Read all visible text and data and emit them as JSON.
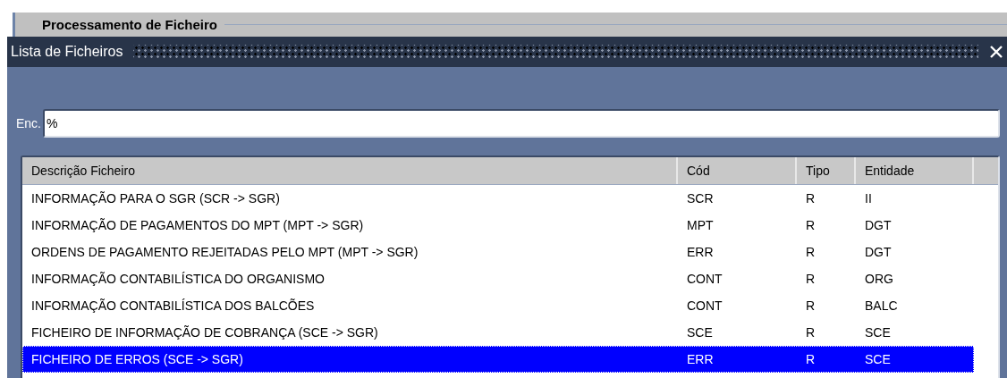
{
  "frame": {
    "title": "Processamento de Ficheiro"
  },
  "dialog": {
    "title": "Lista de Ficheiros"
  },
  "search": {
    "label": "Enc.",
    "value": "%"
  },
  "table": {
    "columns": [
      "Descrição Ficheiro",
      "Cód",
      "Tipo",
      "Entidade"
    ],
    "rows": [
      {
        "cells": [
          "INFORMAÇÃO PARA O SGR (SCR -> SGR)",
          "SCR",
          "R",
          "II"
        ],
        "selected": false
      },
      {
        "cells": [
          "INFORMAÇÃO DE PAGAMENTOS DO MPT (MPT -> SGR)",
          "MPT",
          "R",
          "DGT"
        ],
        "selected": false
      },
      {
        "cells": [
          "ORDENS DE PAGAMENTO REJEITADAS PELO MPT (MPT -> SGR)",
          "ERR",
          "R",
          "DGT"
        ],
        "selected": false
      },
      {
        "cells": [
          "INFORMAÇÃO CONTABILÍSTICA DO ORGANISMO",
          "CONT",
          "R",
          "ORG"
        ],
        "selected": false
      },
      {
        "cells": [
          "INFORMAÇÃO CONTABILÍSTICA DOS BALCÕES",
          "CONT",
          "R",
          "BALC"
        ],
        "selected": false
      },
      {
        "cells": [
          "FICHEIRO DE INFORMAÇÃO DE COBRANÇA (SCE -> SGR)",
          "SCE",
          "R",
          "SCE"
        ],
        "selected": false
      },
      {
        "cells": [
          "FICHEIRO DE ERROS (SCE -> SGR)",
          "ERR",
          "R",
          "SCE"
        ],
        "selected": true
      }
    ]
  }
}
